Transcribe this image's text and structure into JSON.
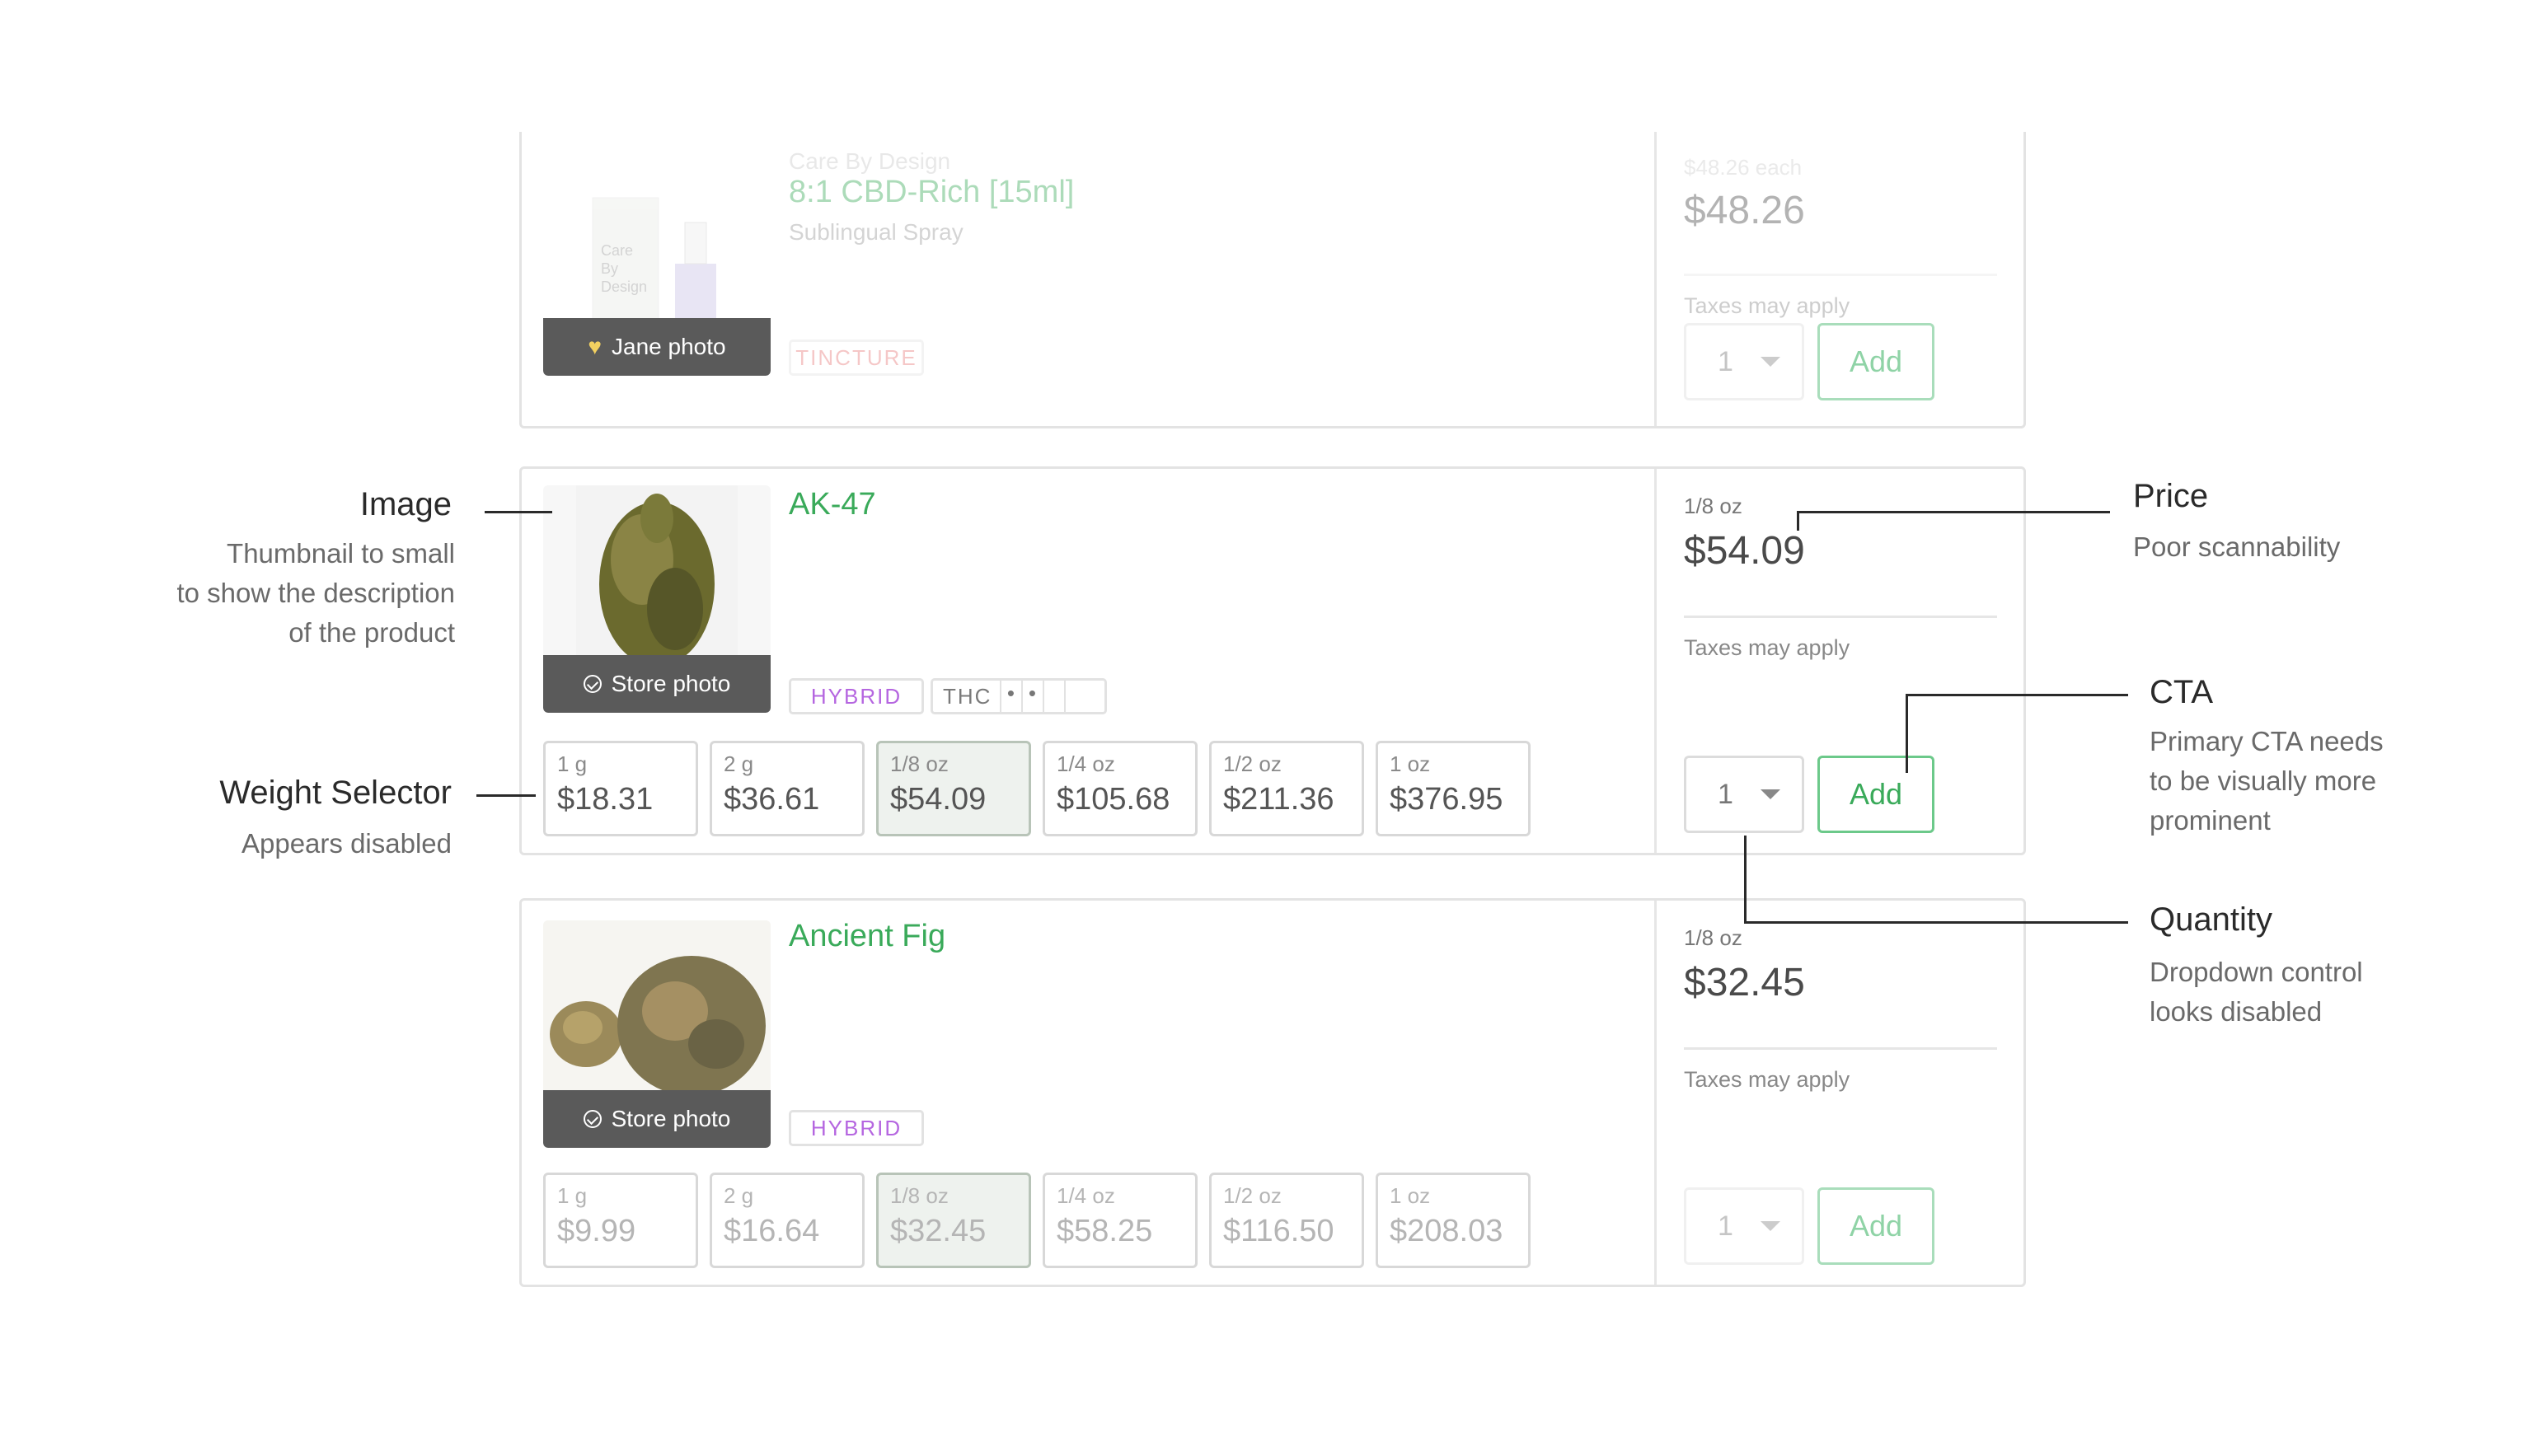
{
  "products": [
    {
      "brand": "Care By Design",
      "name": "8:1 CBD-Rich [15ml]",
      "subtitle": "Sublingual Spray",
      "photo_badge": "Jane photo",
      "tags": [
        "TINCTURE"
      ],
      "each_price": "$48.26 each",
      "price": "$48.26",
      "taxes": "Taxes may apply",
      "quantity": "1",
      "add_label": "Add"
    },
    {
      "name": "AK-47",
      "photo_badge": "Store photo",
      "tags": [
        "HYBRID",
        "THC"
      ],
      "unit": "1/8 oz",
      "price": "$54.09",
      "taxes": "Taxes may apply",
      "quantity": "1",
      "add_label": "Add",
      "weights": [
        {
          "label": "1 g",
          "price": "$18.31",
          "selected": false
        },
        {
          "label": "2 g",
          "price": "$36.61",
          "selected": false
        },
        {
          "label": "1/8 oz",
          "price": "$54.09",
          "selected": true
        },
        {
          "label": "1/4 oz",
          "price": "$105.68",
          "selected": false
        },
        {
          "label": "1/2 oz",
          "price": "$211.36",
          "selected": false
        },
        {
          "label": "1 oz",
          "price": "$376.95",
          "selected": false
        }
      ]
    },
    {
      "name": "Ancient Fig",
      "photo_badge": "Store photo",
      "tags": [
        "HYBRID"
      ],
      "unit": "1/8 oz",
      "price": "$32.45",
      "taxes": "Taxes may apply",
      "quantity": "1",
      "add_label": "Add",
      "weights": [
        {
          "label": "1 g",
          "price": "$9.99",
          "selected": false
        },
        {
          "label": "2 g",
          "price": "$16.64",
          "selected": false
        },
        {
          "label": "1/8 oz",
          "price": "$32.45",
          "selected": true
        },
        {
          "label": "1/4 oz",
          "price": "$58.25",
          "selected": false
        },
        {
          "label": "1/2 oz",
          "price": "$116.50",
          "selected": false
        },
        {
          "label": "1 oz",
          "price": "$208.03",
          "selected": false
        }
      ]
    }
  ],
  "annotations": {
    "image": {
      "title": "Image",
      "lines": [
        "Thumbnail to small",
        "to show the description",
        "of the product"
      ]
    },
    "weight": {
      "title": "Weight Selector",
      "lines": [
        "Appears disabled"
      ]
    },
    "price": {
      "title": "Price",
      "lines": [
        "Poor scannability"
      ]
    },
    "cta": {
      "title": "CTA",
      "lines": [
        "Primary CTA needs",
        "to be visually more",
        "prominent"
      ]
    },
    "quantity": {
      "title": "Quantity",
      "lines": [
        "Dropdown control",
        "looks disabled"
      ]
    }
  },
  "colors": {
    "accent_green": "#3aaa5a",
    "hybrid_purple": "#b566e0",
    "tincture_red": "#e77a7a"
  }
}
